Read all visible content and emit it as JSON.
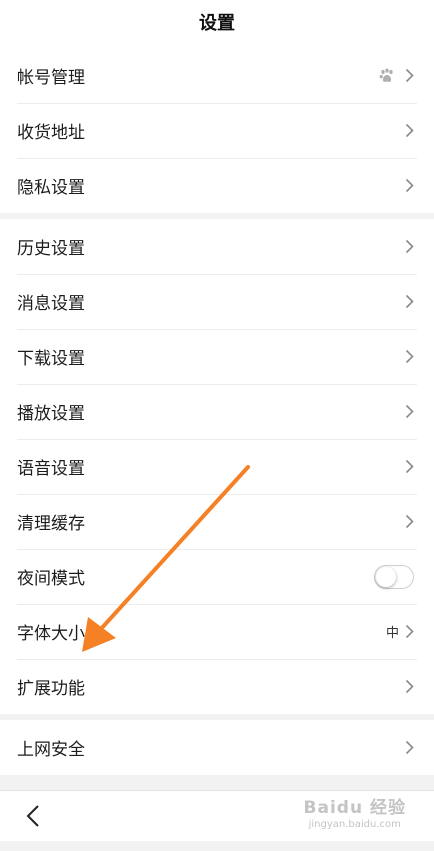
{
  "header": {
    "title": "设置"
  },
  "groups": {
    "account": [
      {
        "label": "帐号管理"
      },
      {
        "label": "收货地址"
      },
      {
        "label": "隐私设置"
      }
    ],
    "general": [
      {
        "label": "历史设置"
      },
      {
        "label": "消息设置"
      },
      {
        "label": "下载设置"
      },
      {
        "label": "播放设置"
      },
      {
        "label": "语音设置"
      },
      {
        "label": "清理缓存"
      },
      {
        "label": "夜间模式"
      },
      {
        "label": "字体大小",
        "value": "中"
      },
      {
        "label": "扩展功能"
      }
    ],
    "security": [
      {
        "label": "上网安全"
      }
    ]
  },
  "night_mode": {
    "enabled": false
  },
  "watermark": {
    "brand": "Baidu 经验",
    "url": "jingyan.baidu.com"
  },
  "icons": {
    "account_status": "paw-icon",
    "row_arrow": "chevron-right-icon",
    "back": "back-chevron-icon"
  },
  "colors": {
    "annotation_arrow": "#f58025",
    "background": "#f2f2f2",
    "toggle_off": "#ffffff"
  }
}
